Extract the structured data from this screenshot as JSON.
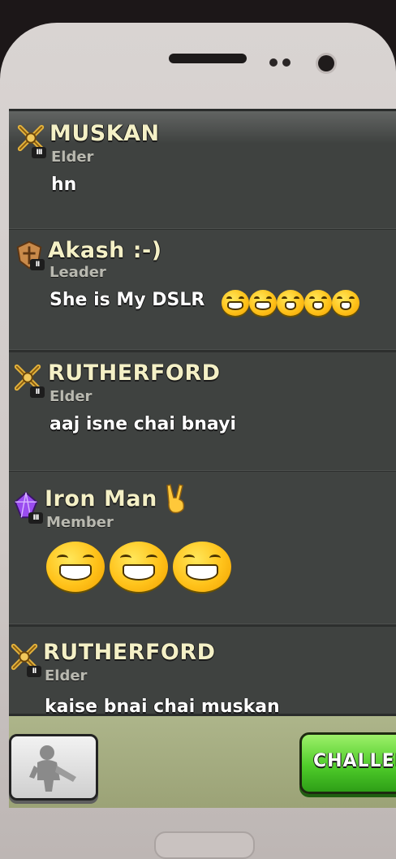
{
  "chat": {
    "messages": [
      {
        "name": "MUSKAN",
        "role": "Elder",
        "text": "hn",
        "badge": "crossed-swords-gold-icon",
        "level": "III"
      },
      {
        "name": "Akash :-)",
        "role": "Leader",
        "text": "She is My DSLR",
        "badge": "shield-bronze-icon",
        "level": "II",
        "emojis": 5
      },
      {
        "name": "RUTHERFORD",
        "role": "Elder",
        "text": "aaj isne chai bnayi",
        "badge": "crossed-swords-gold-icon",
        "level": "II"
      },
      {
        "name": "Iron Man",
        "role": "Member",
        "text": "",
        "badge": "crystal-purple-icon",
        "level": "III",
        "emojis": 3
      },
      {
        "name": "RUTHERFORD",
        "role": "Elder",
        "text": "kaise bnai chai muskan",
        "badge": "crossed-swords-gold-icon",
        "level": "II"
      }
    ]
  },
  "bottom_bar": {
    "challenge_label": "CHALLEN",
    "troop_icon": "barbarian-silhouette-icon"
  },
  "colors": {
    "name": "#f4f0c6",
    "role": "#b9b9b0",
    "text": "#ffffff",
    "panel": "#3f4240",
    "challenge": "#4fcc2a"
  }
}
